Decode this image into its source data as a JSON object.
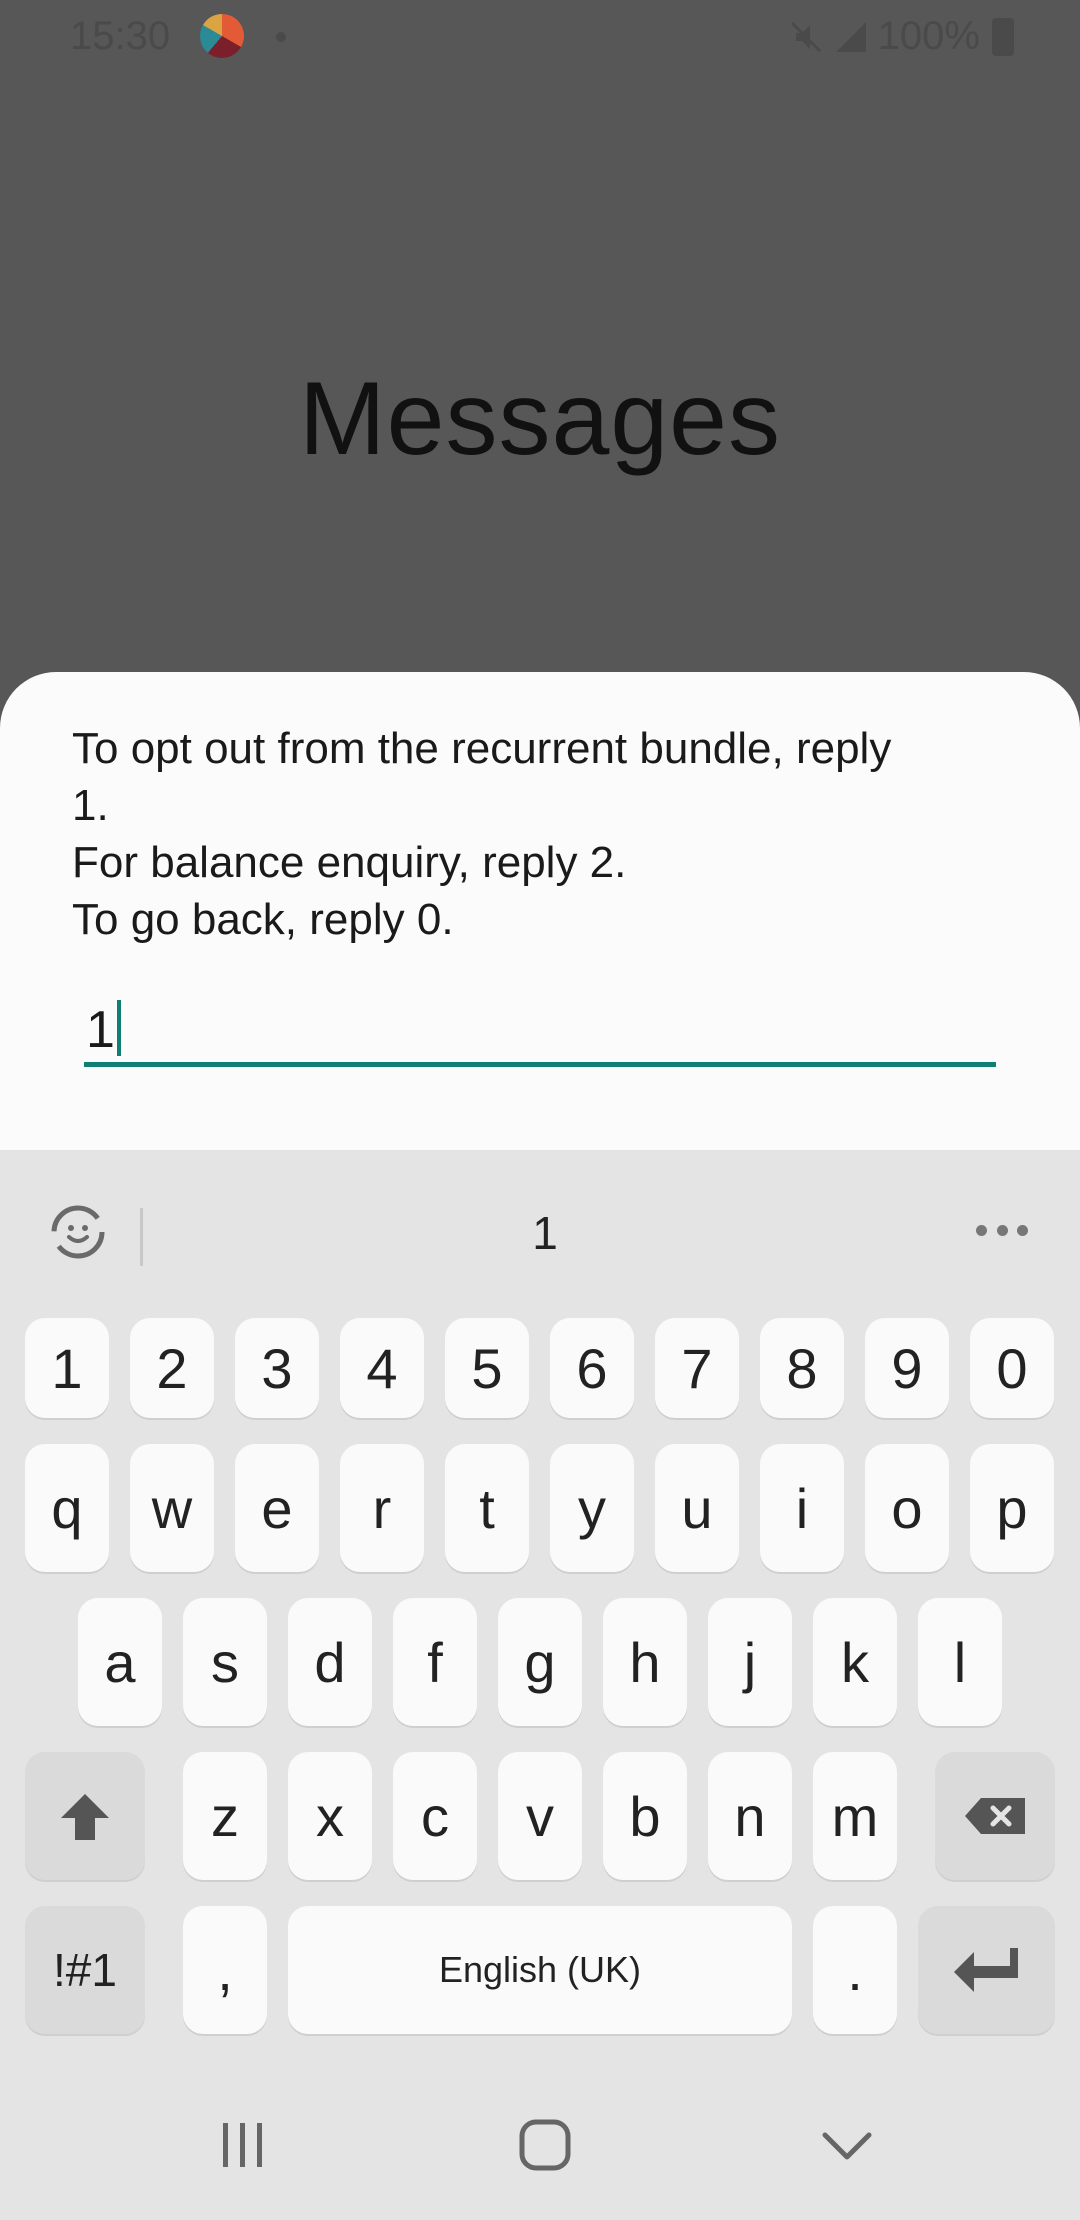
{
  "status_bar": {
    "time": "15:30",
    "battery": "100%",
    "icons": [
      "app-notification-icon",
      "mute-icon",
      "signal-icon",
      "battery-icon"
    ]
  },
  "app": {
    "title": "Messages"
  },
  "dialog": {
    "message": "To opt out from the recurrent bundle, reply\n1.\nFor balance enquiry, reply 2.\nTo go back, reply 0.",
    "input_value": "1"
  },
  "keyboard": {
    "suggestion": "1",
    "number_row": [
      "1",
      "2",
      "3",
      "4",
      "5",
      "6",
      "7",
      "8",
      "9",
      "0"
    ],
    "row1": [
      "q",
      "w",
      "e",
      "r",
      "t",
      "y",
      "u",
      "i",
      "o",
      "p"
    ],
    "row2": [
      "a",
      "s",
      "d",
      "f",
      "g",
      "h",
      "j",
      "k",
      "l"
    ],
    "row3": [
      "z",
      "x",
      "c",
      "v",
      "b",
      "n",
      "m"
    ],
    "symbols_label": "!#1",
    "comma_label": ",",
    "space_label": "English (UK)",
    "period_label": ".",
    "accent_color": "#0f7f73"
  },
  "nav": {
    "icons": [
      "recent-apps-icon",
      "home-icon",
      "hide-keyboard-icon"
    ]
  }
}
